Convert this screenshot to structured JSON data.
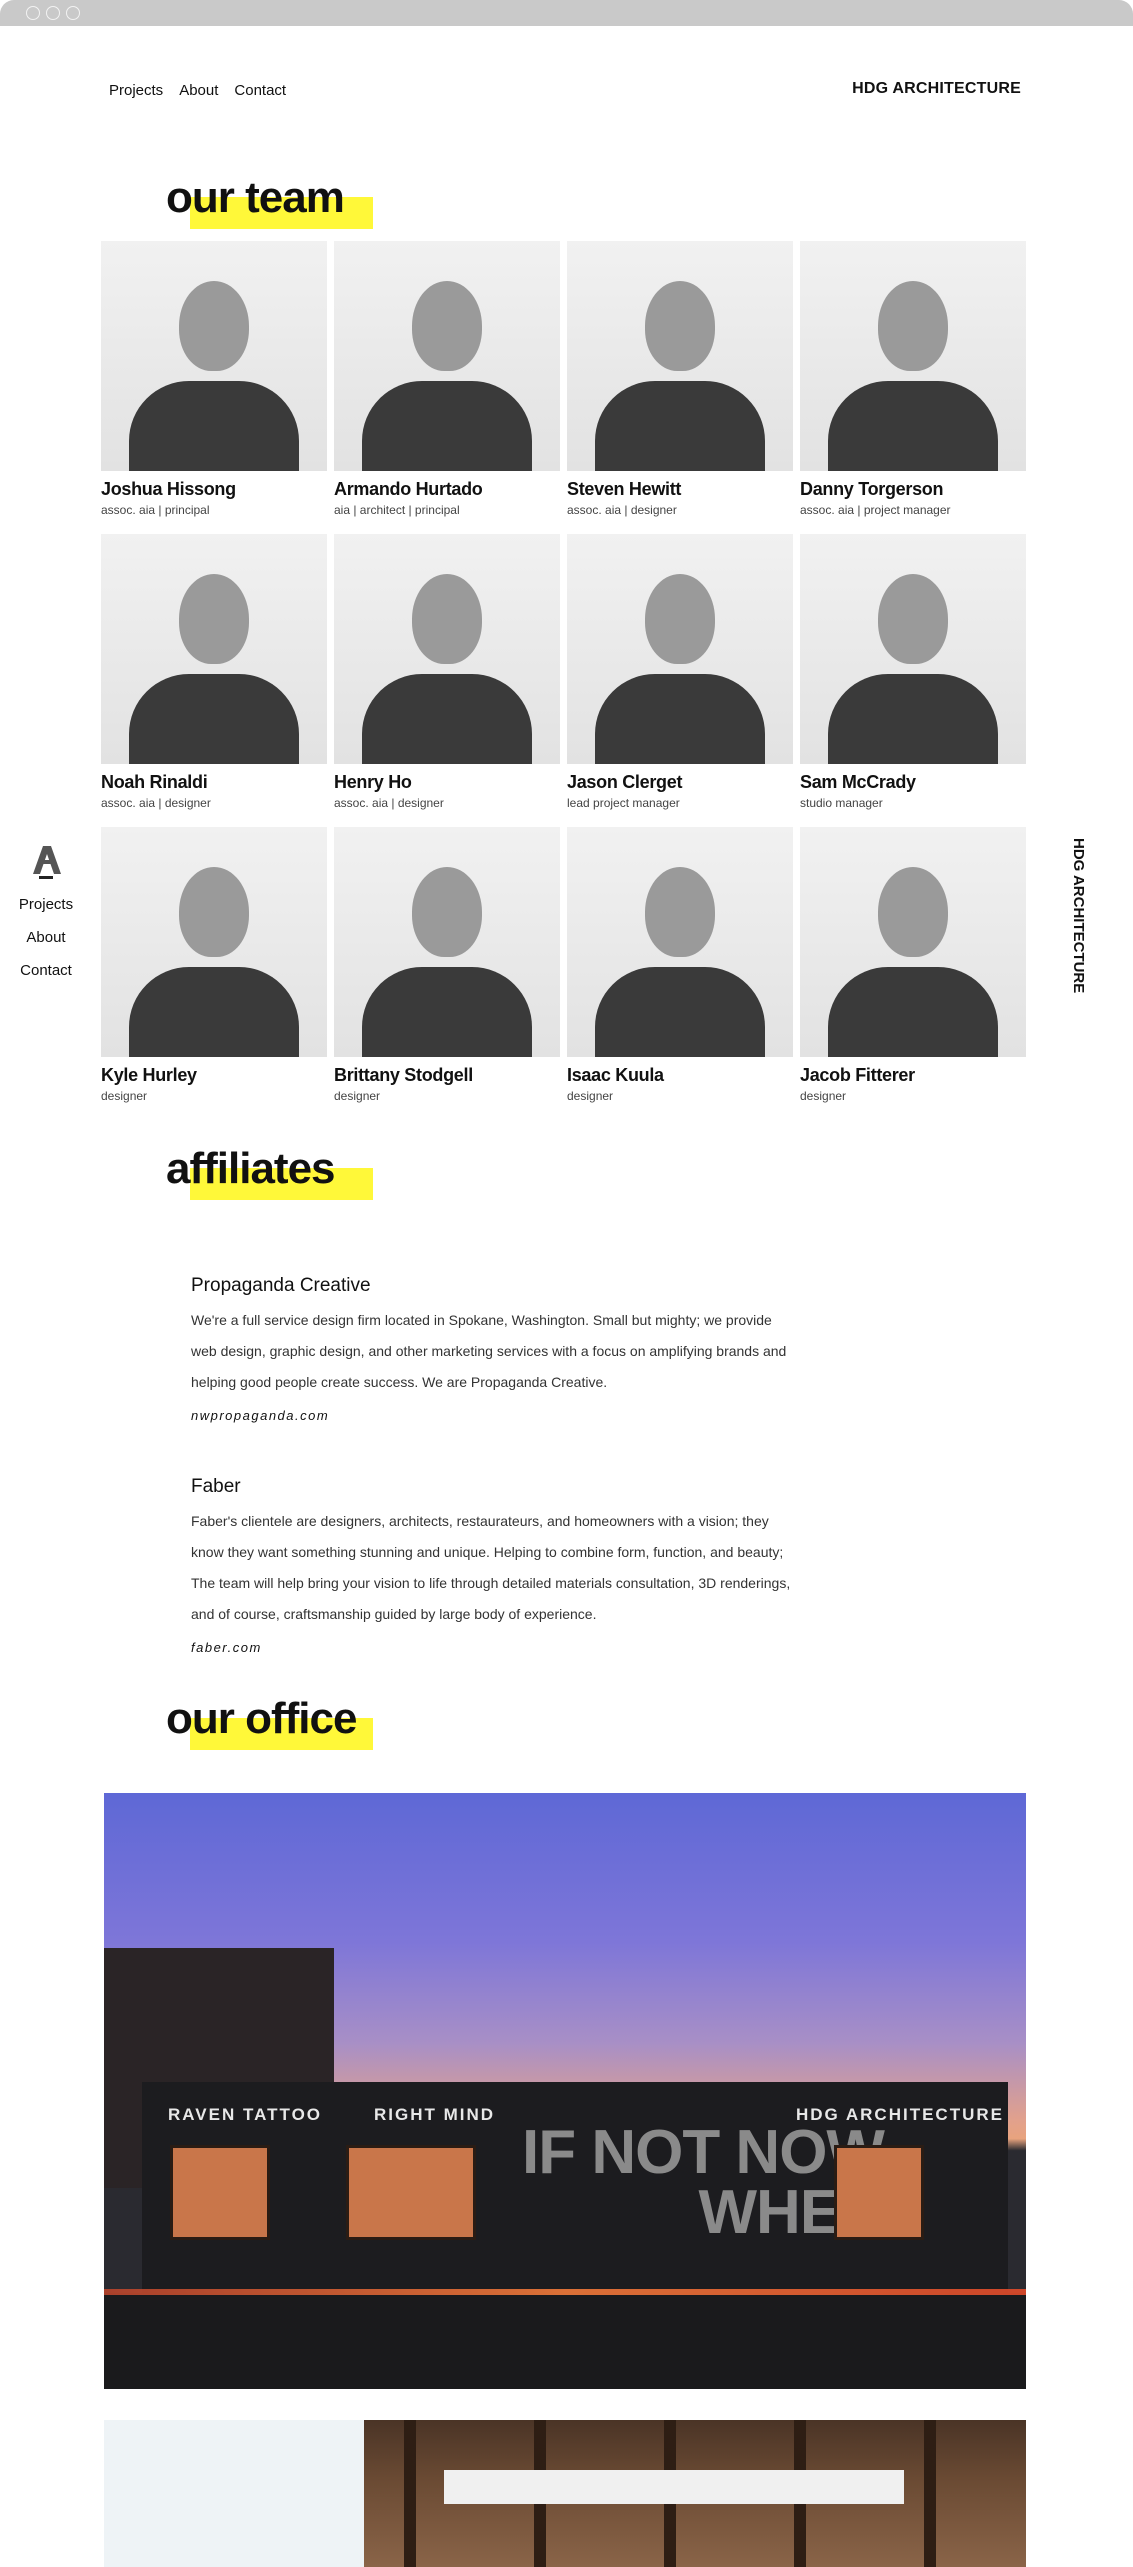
{
  "nav": {
    "items": [
      "Projects",
      "About",
      "Contact"
    ],
    "brand": "HDG ARCHITECTURE"
  },
  "sections": {
    "team": "our team",
    "affiliates": "affiliates",
    "office": "our office"
  },
  "team": [
    {
      "name": "Joshua Hissong",
      "role": "assoc. aia | principal"
    },
    {
      "name": "Armando Hurtado",
      "role": "aia | architect | principal"
    },
    {
      "name": "Steven Hewitt",
      "role": "assoc. aia | designer"
    },
    {
      "name": "Danny Torgerson",
      "role": "assoc. aia | project manager"
    },
    {
      "name": "Noah Rinaldi",
      "role": "assoc. aia | designer"
    },
    {
      "name": "Henry Ho",
      "role": "assoc. aia | designer"
    },
    {
      "name": "Jason Clerget",
      "role": "lead project manager"
    },
    {
      "name": "Sam McCrady",
      "role": "studio manager"
    },
    {
      "name": "Kyle Hurley",
      "role": "designer"
    },
    {
      "name": "Brittany Stodgell",
      "role": "designer"
    },
    {
      "name": "Isaac Kuula",
      "role": "designer"
    },
    {
      "name": "Jacob Fitterer",
      "role": "designer"
    }
  ],
  "sidenav": {
    "items": [
      "Projects",
      "About",
      "Contact"
    ],
    "vertical": "HDG ARCHITECTURE"
  },
  "affiliates": [
    {
      "name": "Propaganda Creative",
      "description": "We're a full service design firm located in Spokane, Washington. Small but mighty; we provide web design, graphic design, and other marketing services with a focus on amplifying brands and helping good people create success. We are Propaganda Creative.",
      "link": "nwpropaganda.com"
    },
    {
      "name": "Faber",
      "description": "Faber's clientele are designers, architects, restaurateurs, and homeowners with a vision; they know they want something stunning and unique. Helping to combine form, function, and beauty; The team will help bring your vision to life through detailed materials consultation, 3D renderings, and of course, craftsmanship guided by large body of experience.",
      "link": "faber.com"
    }
  ],
  "office": {
    "signs": [
      "RAVEN  TATTOO",
      "RIGHT  MIND",
      "HDG  ARCHITECTURE"
    ],
    "mural": [
      "IF NOT NOW",
      "WHEN"
    ]
  },
  "colors": {
    "highlight": "#fff839",
    "chrome": "#c9c9c9"
  }
}
